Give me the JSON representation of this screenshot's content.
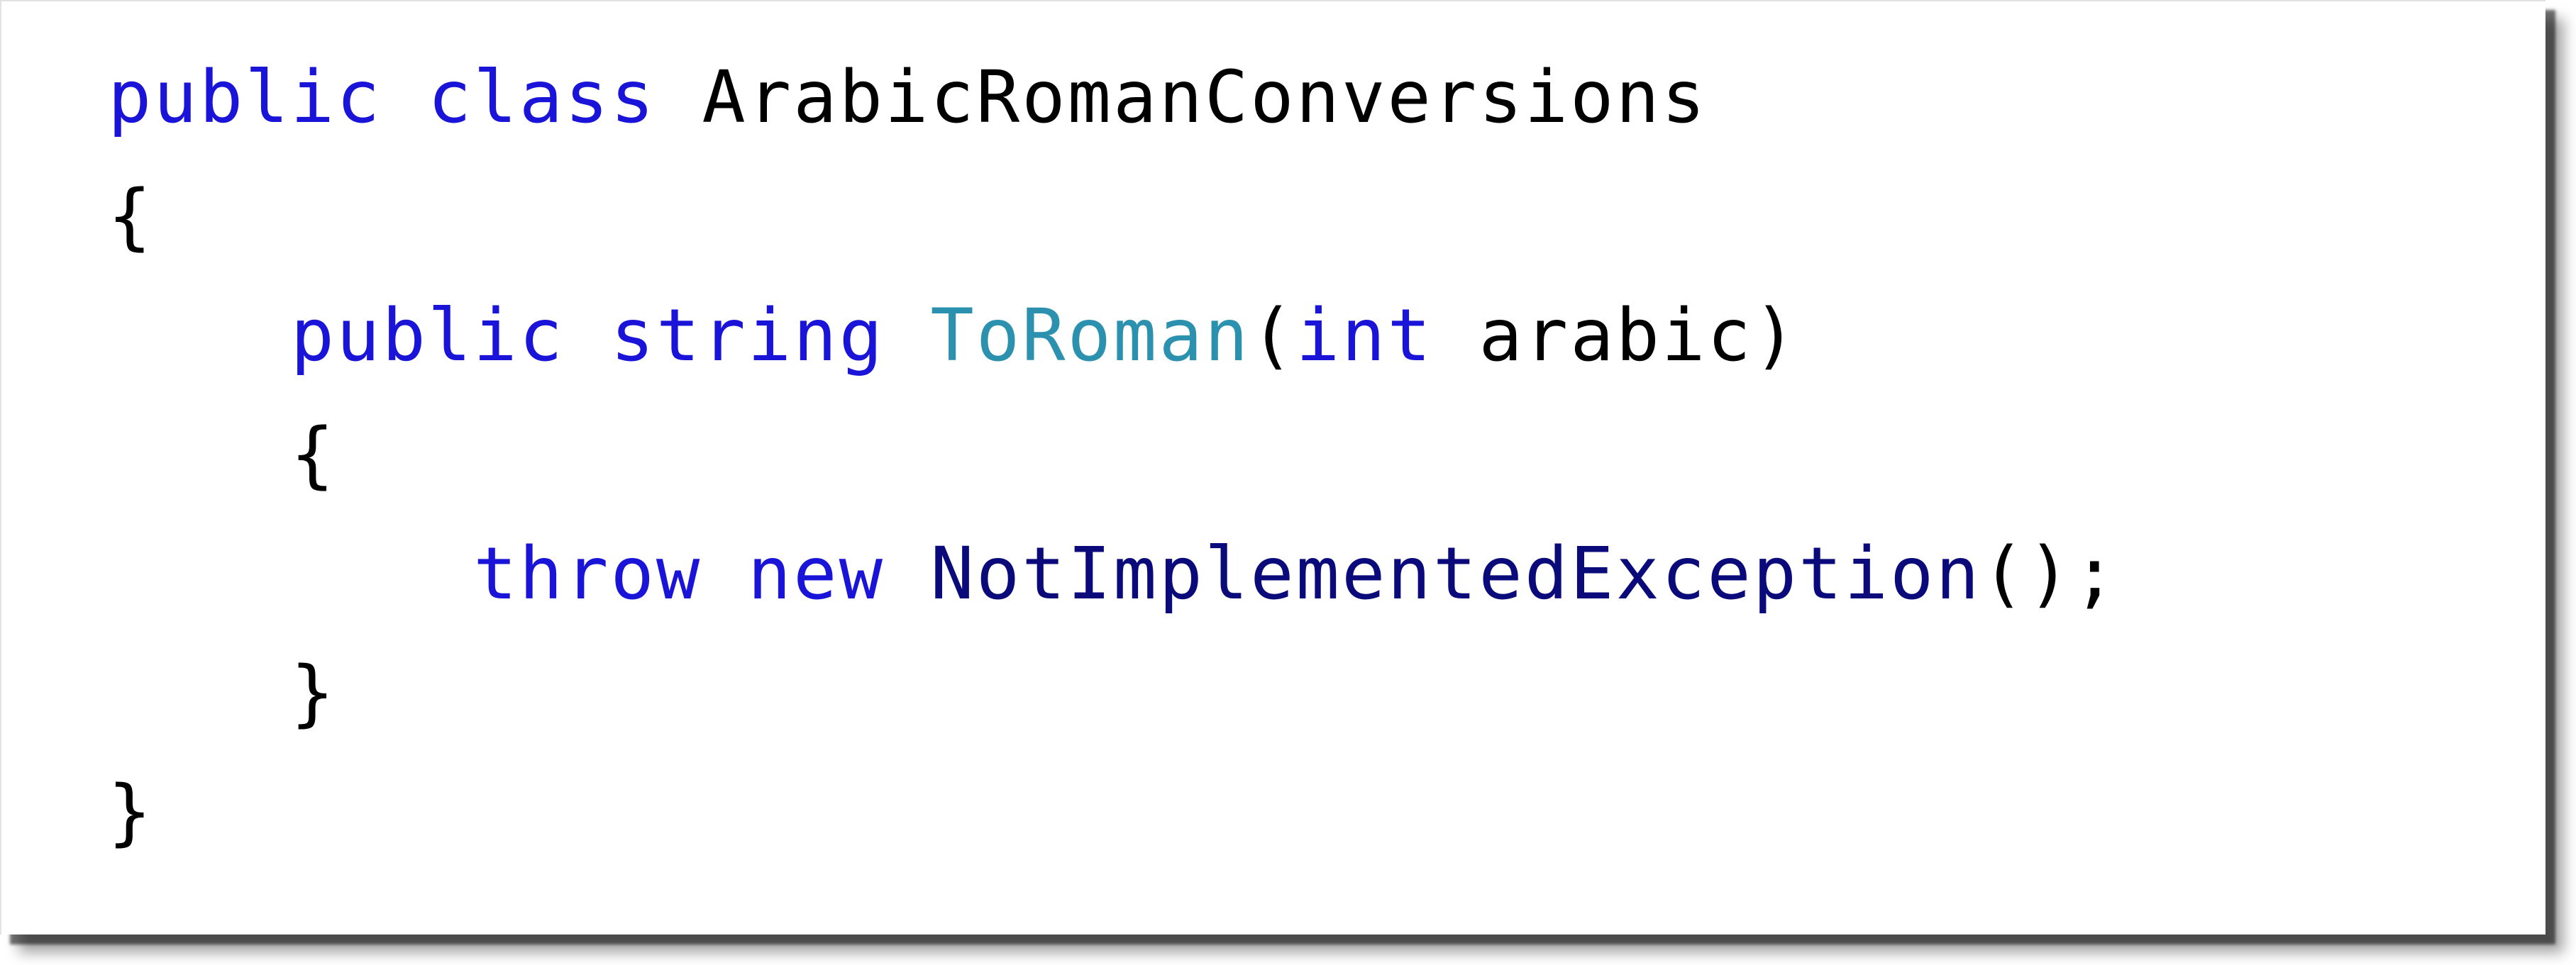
{
  "colors": {
    "keyword": "#1a13d8",
    "class_name": "#2b91af",
    "type_name": "#0a0a7a",
    "plain": "#000000",
    "background": "#ffffff"
  },
  "code": {
    "line1": {
      "kw1": "public",
      "kw2": "class",
      "name": "ArabicRomanConversions"
    },
    "line2": {
      "brace": "{"
    },
    "line3": {
      "kw1": "public",
      "kw2": "string",
      "method": "ToRoman",
      "open_paren": "(",
      "kw3": "int",
      "param": "arabic",
      "close_paren": ")"
    },
    "line4": {
      "brace": "{"
    },
    "line5": {
      "kw1": "throw",
      "kw2": "new",
      "type": "NotImplementedException",
      "tail": "();"
    },
    "line6": {
      "brace": "}"
    },
    "line7": {
      "brace": "}"
    }
  }
}
